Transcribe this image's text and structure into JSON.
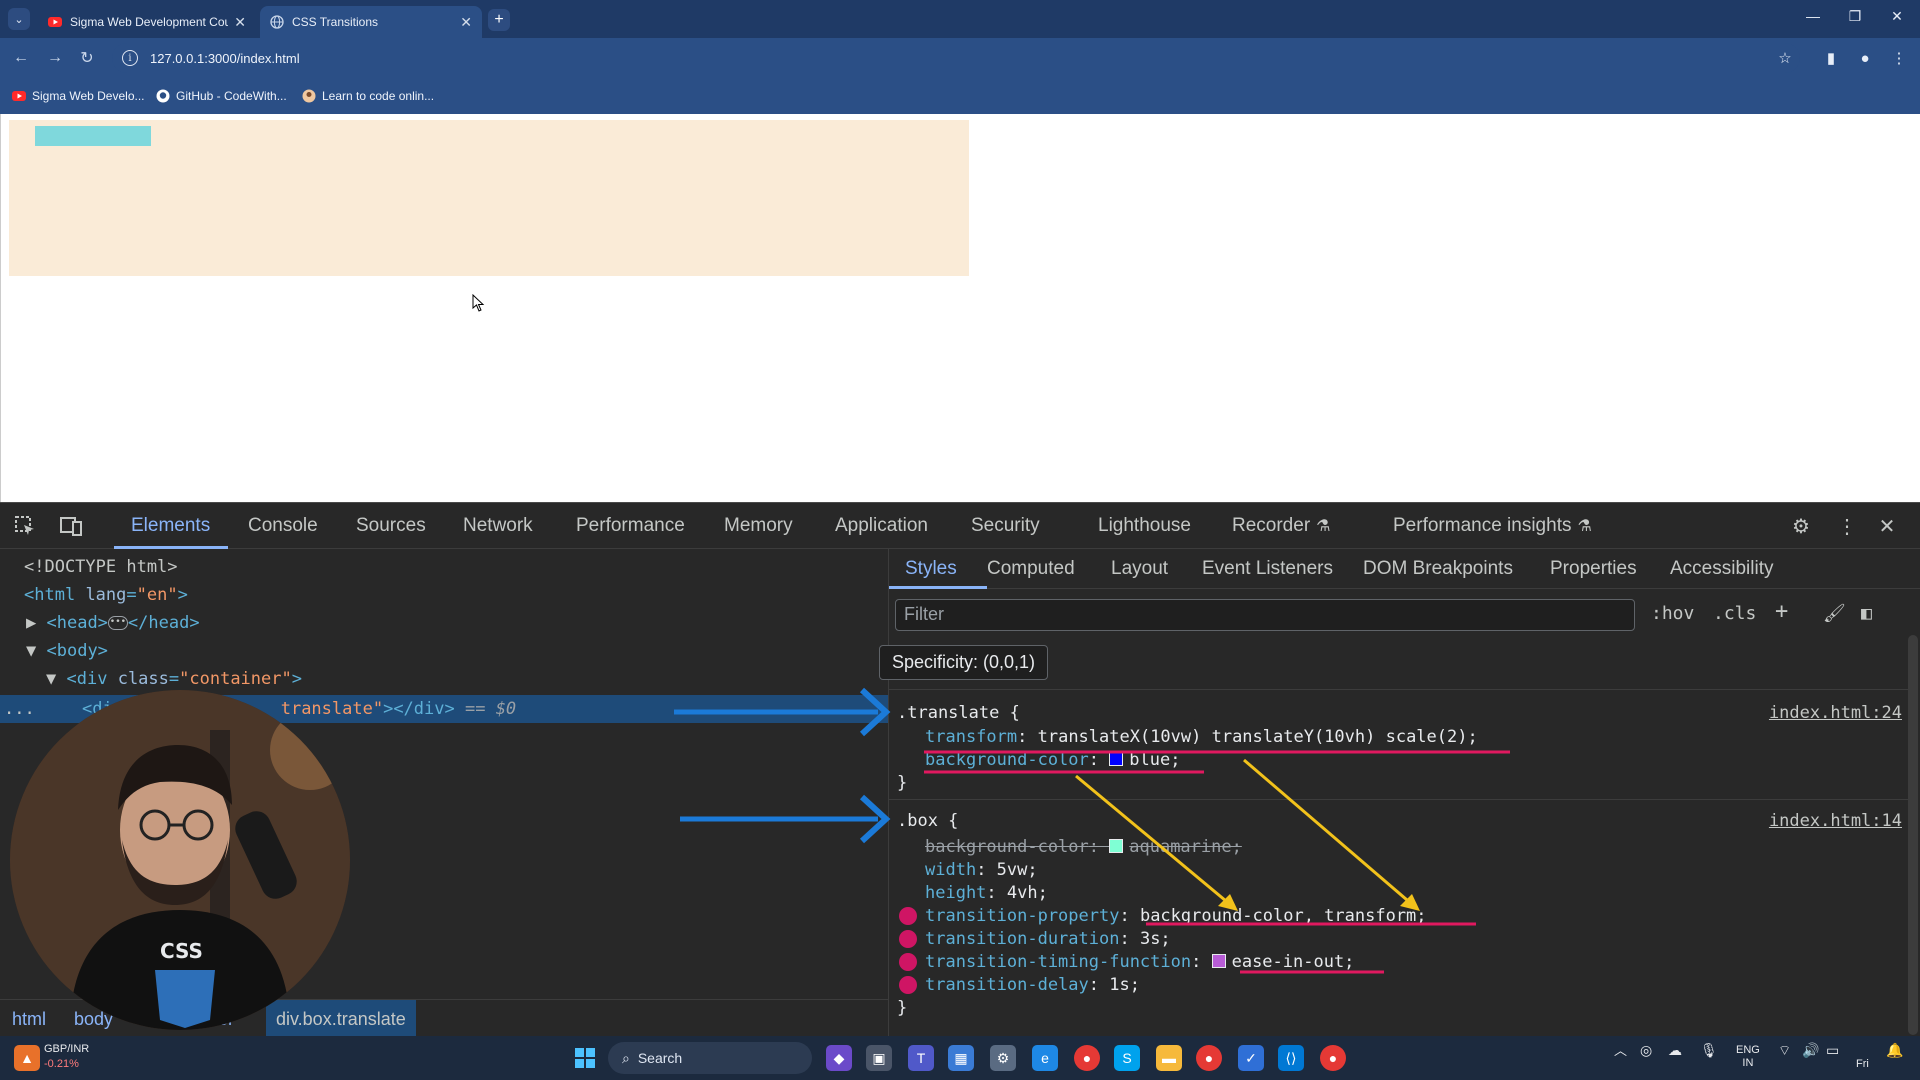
{
  "browser": {
    "tabs": [
      {
        "title": "Sigma Web Development Cou",
        "active": false
      },
      {
        "title": "CSS Transitions",
        "active": true
      }
    ],
    "url": "127.0.0.1:3000/index.html",
    "bookmarks": [
      "Sigma Web Develo...",
      "GitHub - CodeWith...",
      "Learn to code onlin..."
    ]
  },
  "page": {
    "container_color": "#faebd7",
    "box_color": "#7fd8dc"
  },
  "devtools": {
    "tabs": [
      "Elements",
      "Console",
      "Sources",
      "Network",
      "Performance",
      "Memory",
      "Application",
      "Security",
      "Lighthouse",
      "Recorder",
      "Performance insights"
    ],
    "active_tab": "Elements",
    "dom": {
      "doctype": "<!DOCTYPE html>",
      "html_open": "<html",
      "html_attr": "lang",
      "html_val": "\"en\"",
      "head_open": "<head>",
      "head_close": "</head>",
      "body_open": "<body>",
      "div_open": "<div",
      "div_attr": "class",
      "div_val": "\"container\"",
      "selected_prefix": "<di",
      "selected_val": "translate\"",
      "selected_close": "></div>",
      "selected_ref": "== $0",
      "ellipsis": "..."
    },
    "breadcrumbs": [
      "html",
      "body",
      "iner",
      "div.box.translate"
    ],
    "styles_tabs": [
      "Styles",
      "Computed",
      "Layout",
      "Event Listeners",
      "DOM Breakpoints",
      "Properties",
      "Accessibility"
    ],
    "filter_placeholder": "Filter",
    "toolbar": {
      "hov": ":hov",
      "cls": ".cls"
    },
    "tooltip": "Specificity: (0,0,1)",
    "partial_rule": "{",
    "translate_rule": {
      "selector": ".translate {",
      "source": "index.html:24",
      "decls": [
        {
          "prop": "transform",
          "value": "translateX(10vw) translateY(10vh) scale(2);"
        },
        {
          "prop": "background-color",
          "value": "blue;",
          "swatch": "#0000ff"
        }
      ],
      "close": "}"
    },
    "box_rule": {
      "selector": ".box {",
      "source": "index.html:14",
      "decls": [
        {
          "prop": "background-color",
          "value": "aquamarine;",
          "swatch": "#7fffd4",
          "struck": true
        },
        {
          "prop": "width",
          "value": "5vw;"
        },
        {
          "prop": "height",
          "value": "4vh;"
        },
        {
          "prop": "transition-property",
          "value": "background-color, transform;",
          "warn": true
        },
        {
          "prop": "transition-duration",
          "value": "3s;",
          "warn": true
        },
        {
          "prop": "transition-timing-function",
          "value": "ease-in-out;",
          "warn": true,
          "swatch": "#b85cd6"
        },
        {
          "prop": "transition-delay",
          "value": "1s;",
          "warn": true
        }
      ],
      "close": "}"
    }
  },
  "taskbar": {
    "ticker_name": "GBP/INR",
    "ticker_change": "-0.21%",
    "search_label": "Search",
    "lang": "ENG",
    "region": "IN",
    "day": "Fri"
  },
  "colors": {
    "accent": "#8ab4f8",
    "annotation_blue": "#1b7ad8",
    "annotation_yellow": "#f2c21b",
    "annotation_pink": "#e0195f"
  }
}
